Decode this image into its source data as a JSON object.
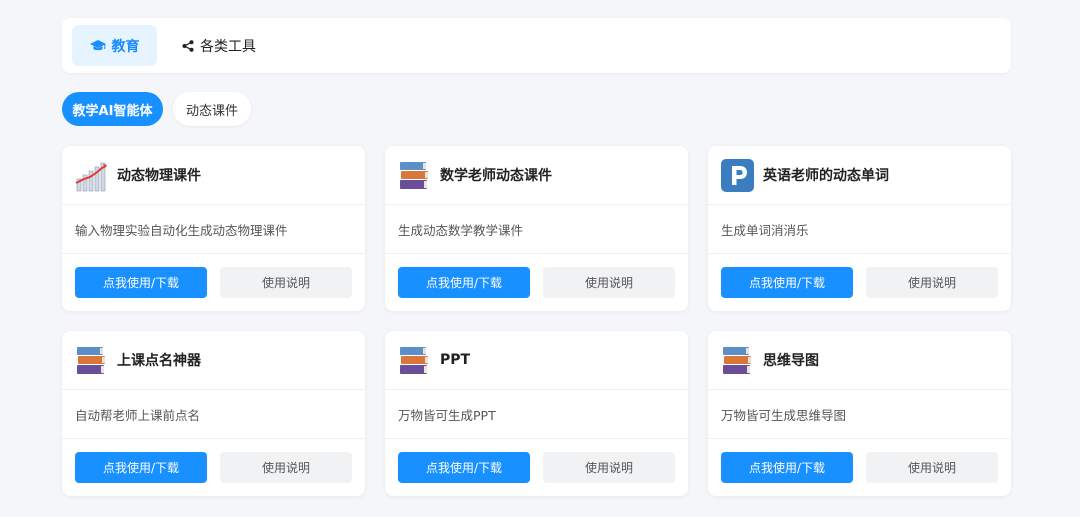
{
  "top_tabs": [
    {
      "label": "教育",
      "icon": "graduation-cap-icon"
    },
    {
      "label": "各类工具",
      "icon": "share-icon"
    }
  ],
  "sub_tabs": [
    {
      "label": "教学AI智能体"
    },
    {
      "label": "动态课件"
    }
  ],
  "cards": [
    {
      "title": "动态物理课件",
      "desc": "输入物理实验自动化生成动态物理课件",
      "icon": "bar-chart-icon",
      "primary": "点我使用/下载",
      "secondary": "使用说明"
    },
    {
      "title": "数学老师动态课件",
      "desc": "生成动态数学教学课件",
      "icon": "books-icon",
      "primary": "点我使用/下载",
      "secondary": "使用说明"
    },
    {
      "title": "英语老师的动态单词",
      "desc": "生成单词消消乐",
      "icon": "p-letter-icon",
      "primary": "点我使用/下载",
      "secondary": "使用说明"
    },
    {
      "title": "上课点名神器",
      "desc": "自动帮老师上课前点名",
      "icon": "books-icon",
      "primary": "点我使用/下载",
      "secondary": "使用说明"
    },
    {
      "title": "PPT",
      "desc": "万物皆可生成PPT",
      "icon": "books-icon",
      "primary": "点我使用/下载",
      "secondary": "使用说明"
    },
    {
      "title": "思维导图",
      "desc": "万物皆可生成思维导图",
      "icon": "books-icon",
      "primary": "点我使用/下载",
      "secondary": "使用说明"
    }
  ],
  "colors": {
    "accent": "#1890ff",
    "accent_light": "#e6f4ff",
    "background": "#f4f6f9"
  }
}
